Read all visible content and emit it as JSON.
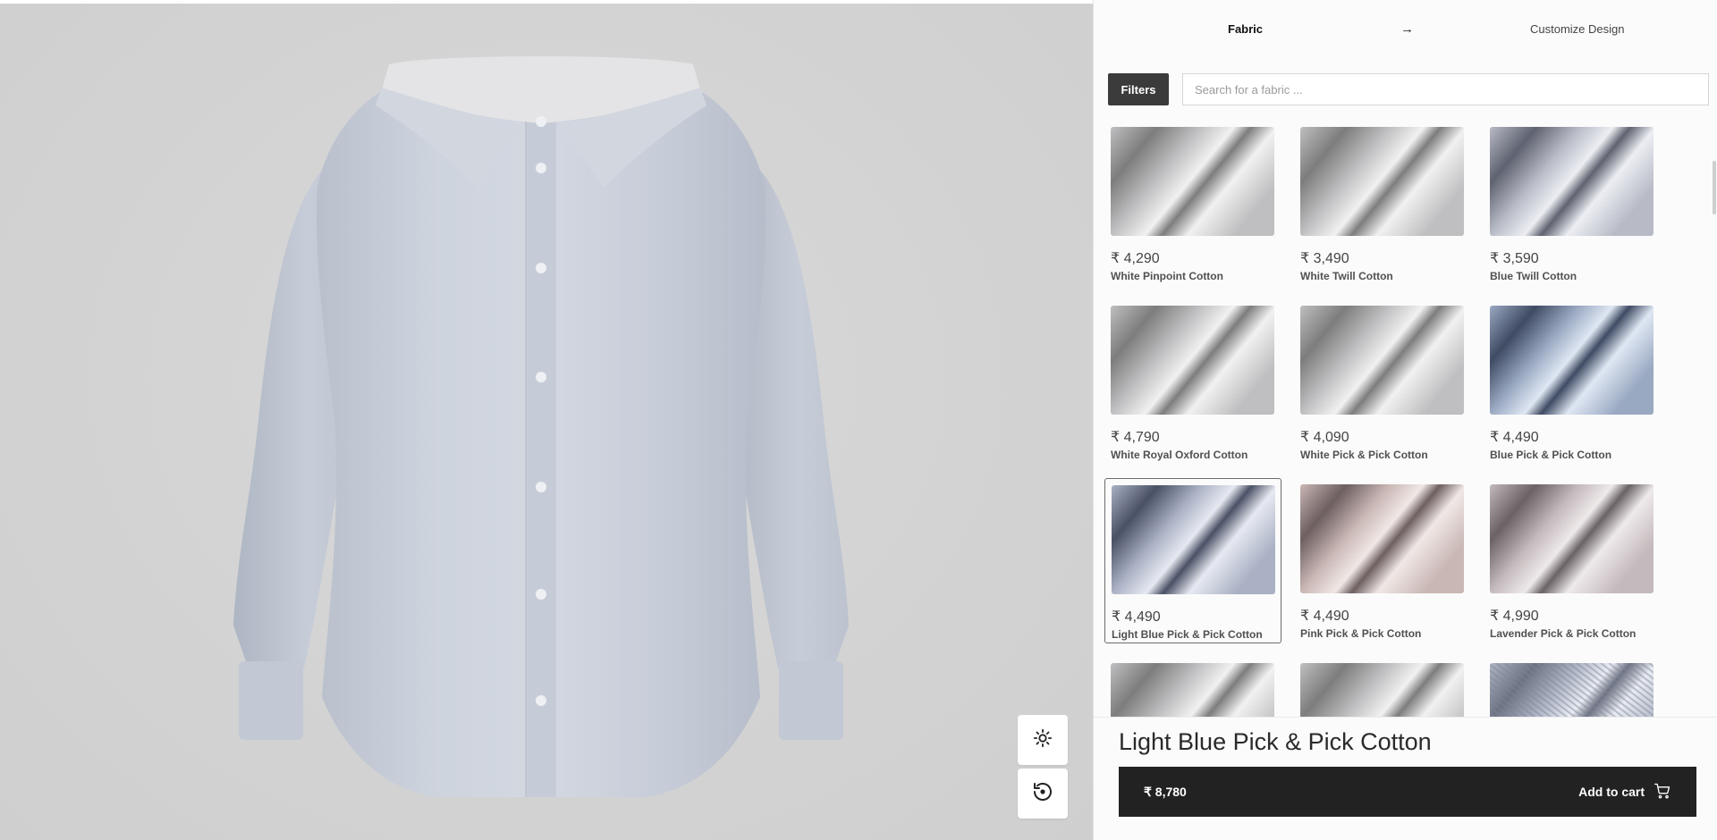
{
  "steps": {
    "current": "Fabric",
    "next": "Customize Design",
    "arrow": "→"
  },
  "filters": {
    "label": "Filters"
  },
  "search": {
    "placeholder": "Search for a fabric ...",
    "value": ""
  },
  "fabrics": [
    {
      "price": "₹ 4,290",
      "name": "White Pinpoint Cotton",
      "tone": "white",
      "selected": false
    },
    {
      "price": "₹ 3,490",
      "name": "White Twill Cotton",
      "tone": "white",
      "selected": false
    },
    {
      "price": "₹ 3,590",
      "name": "Blue Twill Cotton",
      "tone": "bluegray",
      "selected": false
    },
    {
      "price": "₹ 4,790",
      "name": "White Royal Oxford Cotton",
      "tone": "white",
      "selected": false
    },
    {
      "price": "₹ 4,090",
      "name": "White Pick & Pick Cotton",
      "tone": "white",
      "selected": false
    },
    {
      "price": "₹ 4,490",
      "name": "Blue Pick & Pick Cotton",
      "tone": "blue",
      "selected": false
    },
    {
      "price": "₹ 4,490",
      "name": "Light Blue Pick & Pick Cotton",
      "tone": "lightblue",
      "selected": true
    },
    {
      "price": "₹ 4,490",
      "name": "Pink Pick & Pick Cotton",
      "tone": "pink",
      "selected": false
    },
    {
      "price": "₹ 4,990",
      "name": "Lavender Pick & Pick Cotton",
      "tone": "lavender",
      "selected": false
    },
    {
      "price": "",
      "name": "",
      "tone": "white",
      "selected": false
    },
    {
      "price": "",
      "name": "",
      "tone": "white",
      "selected": false
    },
    {
      "price": "",
      "name": "",
      "tone": "stripe",
      "selected": false
    }
  ],
  "selection": {
    "name": "Light Blue Pick & Pick Cotton",
    "total": "₹ 8,780"
  },
  "cart": {
    "label": "Add to cart"
  },
  "viewer": {
    "light_icon": "sun-icon",
    "reset_icon": "reset-view-icon",
    "cart_icon": "cart-icon"
  },
  "colors": {
    "shirt": "#c9cfd9",
    "panel_bg": "#fbfbfb",
    "cart_bar": "#222222",
    "filters_btn": "#3b3b3b",
    "white": [
      "#7d7d7d",
      "#f1f1f1",
      "#bfbfc1"
    ],
    "bluegray": [
      "#5f6270",
      "#eceef3",
      "#b8bbc6"
    ],
    "blue": [
      "#3f4b63",
      "#dfe7f3",
      "#9aa9c2"
    ],
    "lightblue": [
      "#4a5165",
      "#e6e9f1",
      "#aab1c4"
    ],
    "pink": [
      "#6e5f60",
      "#f0e8e6",
      "#c9b7b5"
    ],
    "lavender": [
      "#6a6265",
      "#eee9ea",
      "#c4b9bc"
    ],
    "stripe": [
      "#6d7282",
      "#e9ecf2",
      "#b0b6c6"
    ]
  }
}
